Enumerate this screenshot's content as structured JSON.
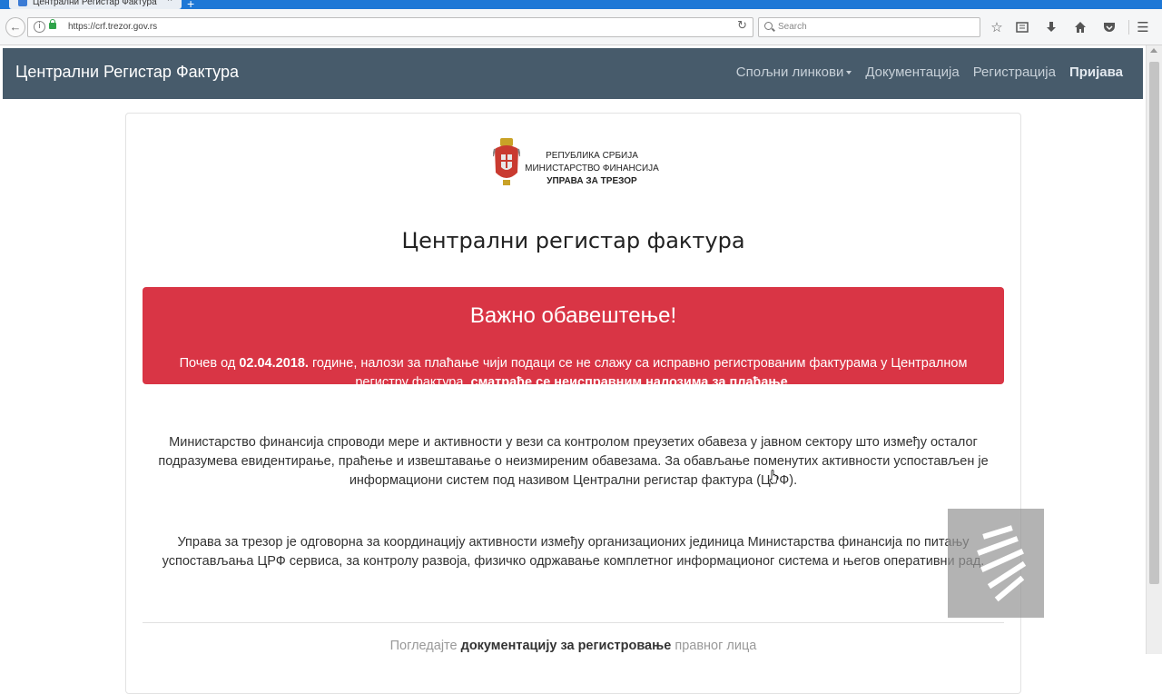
{
  "browser": {
    "tab_title": "Централни Регистар Фактура",
    "tab_close": "×",
    "new_tab": "+",
    "url": "https://crf.trezor.gov.rs",
    "search_placeholder": "Search",
    "icons": [
      "back-icon",
      "info-icon",
      "lock-icon",
      "reload-icon",
      "search-icon",
      "star-icon",
      "reading-list-icon",
      "download-icon",
      "home-icon",
      "pocket-icon",
      "menu-icon"
    ]
  },
  "navbar": {
    "brand": "Централни Регистар Фактура",
    "links": [
      {
        "label": "Спољни линкови",
        "dropdown": true
      },
      {
        "label": "Документација"
      },
      {
        "label": "Регистрација"
      },
      {
        "label": "Пријава",
        "active": true
      }
    ],
    "background": "#475b6b"
  },
  "header": {
    "ministry_line1": "РЕПУБЛИКА СРБИЈА",
    "ministry_line2": "МИНИСТАРСТВО ФИНАНСИЈА",
    "ministry_line3": "УПРАВА ЗА ТРЕЗОР",
    "page_title": "Централни регистар фактура"
  },
  "alert": {
    "title": "Важно обавештење!",
    "text_part1": "Почев од ",
    "date": "02.04.2018.",
    "text_part2": " године, налози за плаћање чији подаци се не слажу са исправно регистрованим фактурама у Централном регистру фактура, ",
    "text_bold": "сматраће се неисправним налозима за плаћање",
    "text_end": ".",
    "color": "#d93545"
  },
  "content": {
    "paragraph1": "Министарство финансија спроводи мере и активности у вези са контролом преузетих обавеза у јавном сектору што између осталог подразумева евидентирање, праћење и извештавање о неизмиреним обавезама. За обављање поменутих активности успостављен је информациони систем под називом Централни регистар фактура (ЦРФ).",
    "paragraph2": "Управа за трезор је одговорна за координацију активности између организационих јединица Министарства финансија по питању успостављања ЦРФ сервиса, за контролу развоја, физичко одржавање комплетног информационог система и његов оперативни рад.",
    "footer_prefix": "Погледајте ",
    "footer_link": "документацију за регистровање",
    "footer_suffix": " правног лица"
  }
}
